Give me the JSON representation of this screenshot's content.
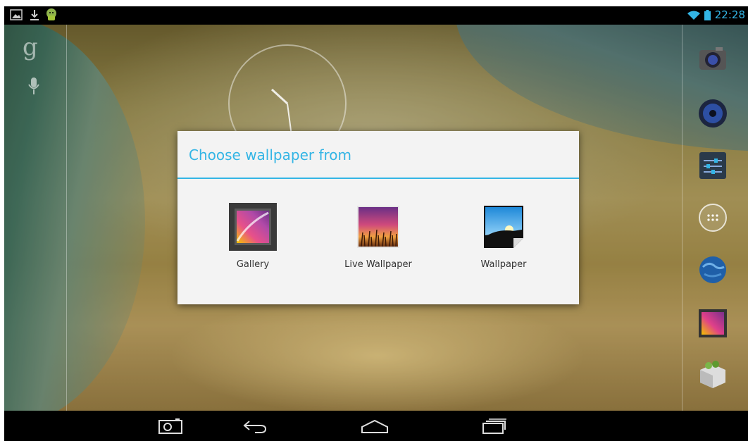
{
  "status_bar": {
    "time": "22:28",
    "left_icons": [
      "gallery-notification-icon",
      "download-icon",
      "android-icon"
    ],
    "right_icons": [
      "wifi-icon",
      "battery-icon"
    ],
    "accent": "#33b5e5"
  },
  "home": {
    "left_icons": [
      "google-search-icon",
      "voice-search-icon"
    ],
    "dock": [
      "camera-icon",
      "music-icon",
      "settings-icon",
      "all-apps-icon",
      "browser-icon",
      "gallery-icon",
      "app-market-icon"
    ]
  },
  "dialog": {
    "title": "Choose wallpaper from",
    "options": [
      {
        "label": "Gallery",
        "icon": "gallery-icon"
      },
      {
        "label": "Live Wallpaper",
        "icon": "live-wallpaper-icon"
      },
      {
        "label": "Wallpaper",
        "icon": "wallpaper-icon"
      }
    ]
  },
  "nav_bar": {
    "buttons": [
      "screenshot-icon",
      "back-icon",
      "home-icon",
      "recent-apps-icon"
    ]
  }
}
